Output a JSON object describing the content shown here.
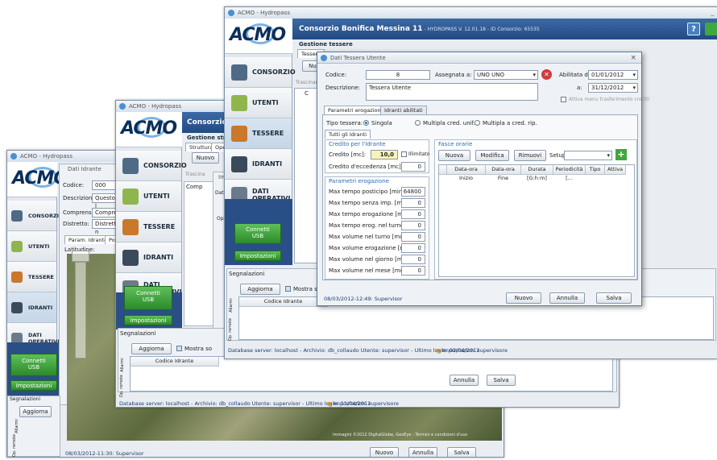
{
  "app": {
    "window_title": "ACMO - Hydropass",
    "logo": "ACMO",
    "header_title": "Consorzio Bonifica Messina 11",
    "header_sub": " - HYDROPASS V. 12.01.18 - ID Consorzio: 65535",
    "header_short": "Consorzio Boni",
    "help_icon": "?",
    "min_label": "_",
    "close_label": "×"
  },
  "nav": {
    "consorzio": "CONSORZIO",
    "utenti": "UTENTI",
    "tessere": "TESSERE",
    "idranti": "IDRANTI",
    "dati_operativi_1": "DATI",
    "dati_operativi_2": "OPERATIVI",
    "usb_1": "Connetti",
    "usb_2": "USB",
    "impostazioni": "Impostazioni"
  },
  "win1": {
    "sub_title": "Dati Idrante",
    "codice_label": "Codice:",
    "codice_value": "000",
    "descrizione_label": "Descrizione:",
    "descrizione_value": "Questo è l",
    "comprensorio_label": "Comprensorio:",
    "comprensorio_value": "Compren",
    "distretto_label": "Distretto:",
    "distretto_value": "Distretto n",
    "tab1": "Param. Idrante",
    "tab2": "Pos",
    "latitudine_label": "Latitudine:",
    "signal_label": "Segnalazioni",
    "aggiorna": "Aggiorna",
    "side_allarmi": "Allarmi",
    "side_remote": "Op. remote",
    "status": "08/03/2012-11:30: Supervisor",
    "nuovo": "Nuovo",
    "annulla": "Annulla",
    "salva": "Salva",
    "map_credit": "Immagini ©2012 DigitalGlobe, GeoEye - Termini e condizioni d'uso"
  },
  "win2": {
    "section": "Gestione strutt",
    "tab_struttura": "Struttura",
    "tab_ope": "Ope",
    "nuovo": "Nuovo",
    "trascina": "Trascina",
    "comp": "Comp",
    "impo_dialog": "Impo",
    "dati": "Dati",
    "opt": "Opz",
    "signal_label": "Segnalazioni",
    "aggiorna": "Aggiorna",
    "mostra": "Mostra so",
    "codice_idrante": "Codice Idrante",
    "side_allarmi": "Allarmi",
    "side_remote": "Op. remote",
    "status_bar": "Database server: localhost - Archivio: db_collaudo    Utente: supervisor - Ultimo login: 11/04/2012",
    "impost_sup": "Impostazioni supervisore",
    "annulla": "Annulla",
    "salva": "Salva"
  },
  "win3": {
    "section": "Gestione tessere",
    "tab_tessere": "Tessere",
    "nu": "Nu",
    "trascina": "Trascinar",
    "c": "C",
    "signal_label": "Segnalazioni",
    "aggiorna": "Aggiorna",
    "mostra": "Mostra sol",
    "codice_idrante": "Codice Idrante",
    "side_allarmi": "Allarmi",
    "side_remote": "Op. remote",
    "status_bar": "Database server: localhost - Archivio: db_collaudo    Utente: supervisor - Ultimo login: 02/04/2012",
    "impost_sup": "Impostazioni supervisore"
  },
  "dialog": {
    "title": "Dati Tessera Utente",
    "codice_label": "Codice:",
    "codice_value": "8",
    "assegnata_label": "Assegnata a:",
    "assegnata_value": "UNO UNO",
    "abilitata_label": "Abilitata da:",
    "abilitata_value": "01/01/2012",
    "a_label": "a:",
    "a_value": "31/12/2012",
    "descrizione_label": "Descrizione:",
    "descrizione_value": "Tessera Utente",
    "menu_label": "Attiva menu trasferimento crediti",
    "tab_param": "Parametri erogazione",
    "tab_idranti": "Idranti abilitati",
    "tipo_label": "Tipo tessera:",
    "tipo_singola": "Singola",
    "tipo_multipla_unif": "Multipla cred. unif.",
    "tipo_multipla_rip": "Multipla a cred. rip.",
    "tab_tutti": "Tutti gli Idranti",
    "credito_group": "Credito per l'Idrante",
    "credito_label": "Credito [mc]:",
    "credito_value": "10,0",
    "illimitato": "Illimitato",
    "eccedenza_label": "Credito d'eccedenza [mc]:",
    "eccedenza_value": "0",
    "param_group": "Parametri erogazione",
    "params": [
      {
        "label": "Max tempo posticipo [min]:",
        "value": "64800"
      },
      {
        "label": "Max tempo senza imp. [min]:",
        "value": "0"
      },
      {
        "label": "Max tempo erogazione [min]:",
        "value": "0"
      },
      {
        "label": "Max tempo erog. nel turno [min]:",
        "value": "0"
      },
      {
        "label": "Max volume nel turno [mc]:",
        "value": "0"
      },
      {
        "label": "Max volume erogazione [mc]:",
        "value": "0"
      },
      {
        "label": "Max volume nel giorno [mc]:",
        "value": "0"
      },
      {
        "label": "Max volume nel mese [mc]:",
        "value": "0"
      }
    ],
    "fasce_group": "Fasce orarie",
    "nuova": "Nuova",
    "modifica": "Modifica",
    "rimuovi": "Rimuovi",
    "setups_label": "Setups:",
    "cols": [
      "Data-ora Inizio",
      "Data-ora Fine",
      "Durata [G:h:m]",
      "Periodicità [...",
      "Tipo",
      "Attiva"
    ],
    "status": "08/03/2012-12:49: Supervisor",
    "nuovo": "Nuovo",
    "annulla": "Annulla",
    "salva": "Salva"
  }
}
